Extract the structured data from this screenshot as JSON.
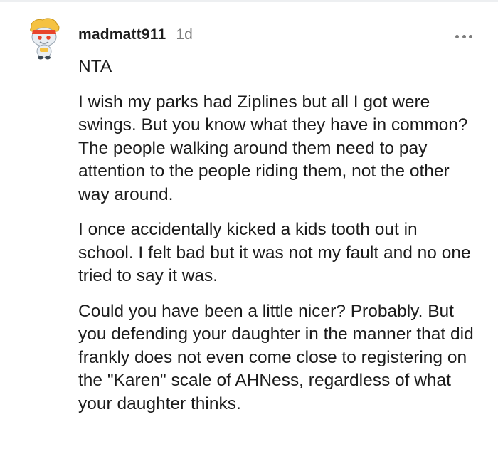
{
  "comment": {
    "username": "madmatt911",
    "timestamp": "1d",
    "avatar_icon": "reddit-snoo-avatar-icon",
    "more_icon": "more-options-icon",
    "paragraphs": [
      "NTA",
      "I wish my parks had Ziplines but all I got were swings. But you know what they have in common? The people walking around them need to pay attention to the people riding them, not the other way around.",
      "I once accidentally kicked a kids tooth out in school. I felt bad but it was not my fault and no one tried to say it was.",
      "Could you have been a little nicer? Probably. But you defending your daughter in the manner that did frankly does not even come close to registering on the \"Karen\" scale of AHNess, regardless of what your daughter thinks."
    ]
  },
  "colors": {
    "text": "#1c1c1c",
    "meta": "#7c7c7c",
    "divider": "#edeff1",
    "avatar_hair": "#f5c242",
    "avatar_band": "#e8452c"
  }
}
